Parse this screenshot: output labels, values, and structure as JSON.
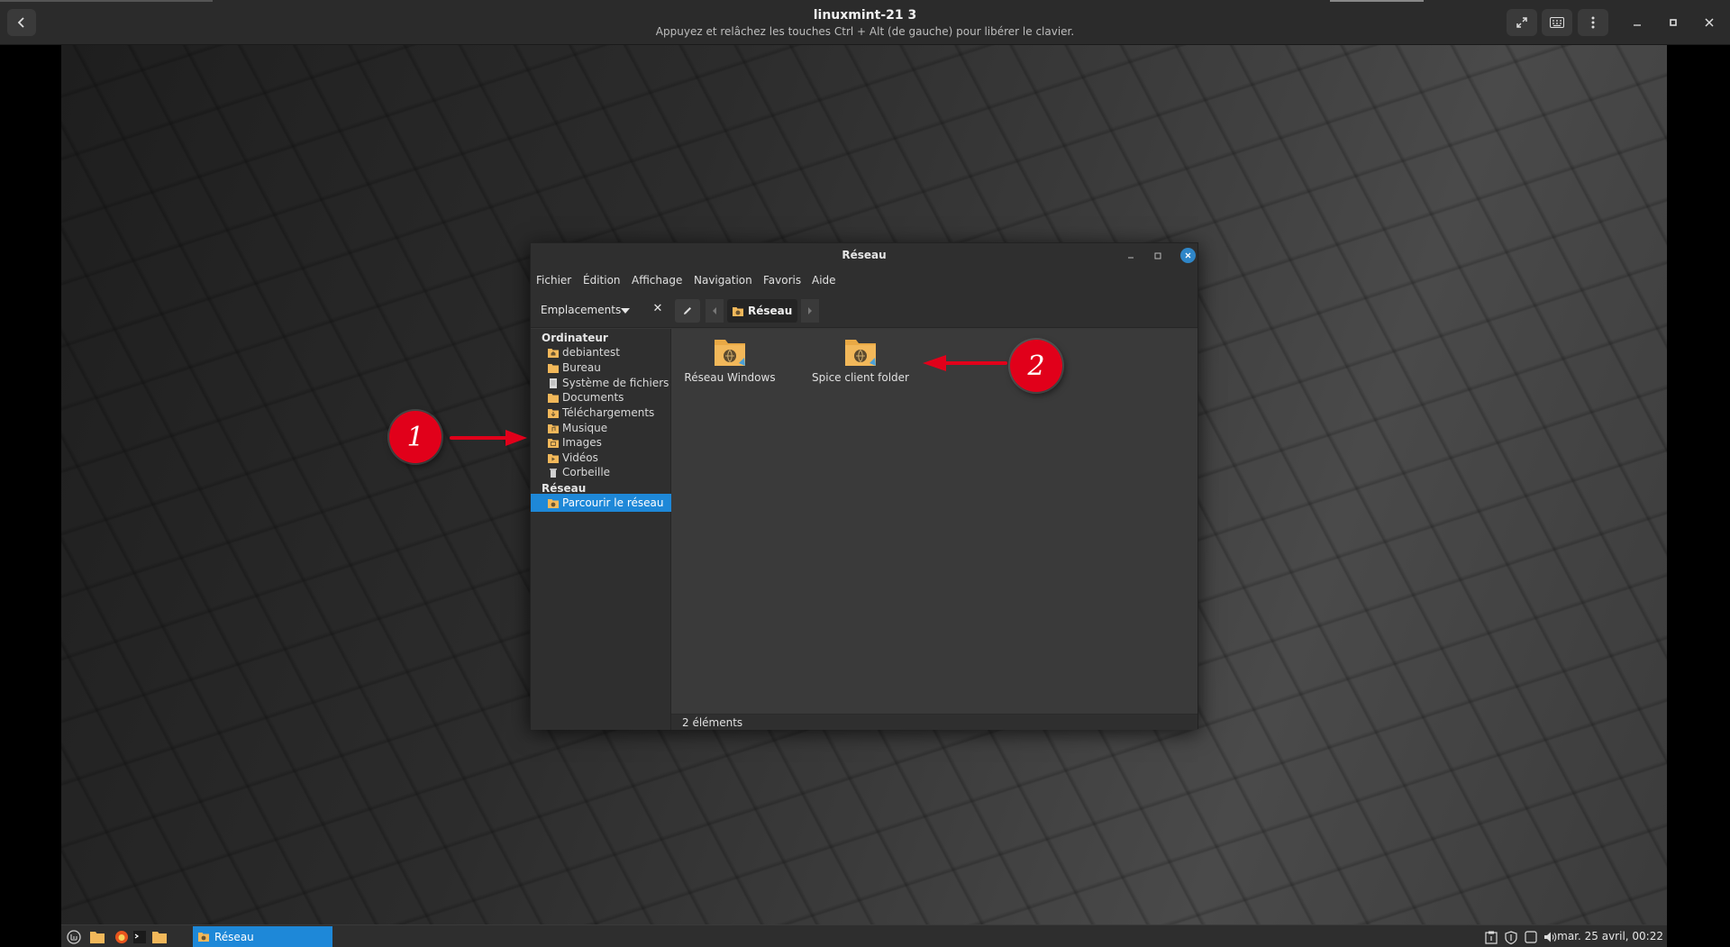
{
  "host": {
    "title": "linuxmint-21 3",
    "subtitle": "Appuyez et relâchez les touches Ctrl + Alt (de gauche) pour libérer le clavier.",
    "buttons": [
      "back-icon",
      "fullscreen-icon",
      "keyboard-icon",
      "kebab-menu-icon",
      "minimize-icon",
      "maximize-icon",
      "close-icon"
    ]
  },
  "window": {
    "title": "Réseau",
    "menu": [
      "Fichier",
      "Édition",
      "Affichage",
      "Navigation",
      "Favoris",
      "Aide"
    ],
    "toolbar": {
      "places_label": "Emplacements",
      "breadcrumb": "Réseau"
    },
    "sidebar": {
      "computer_heading": "Ordinateur",
      "computer_items": [
        {
          "label": "debiantest",
          "icon": "home-folder-icon"
        },
        {
          "label": "Bureau",
          "icon": "desktop-folder-icon"
        },
        {
          "label": "Système de fichiers",
          "icon": "filesystem-icon"
        },
        {
          "label": "Documents",
          "icon": "documents-folder-icon"
        },
        {
          "label": "Téléchargements",
          "icon": "downloads-folder-icon"
        },
        {
          "label": "Musique",
          "icon": "music-folder-icon"
        },
        {
          "label": "Images",
          "icon": "pictures-folder-icon"
        },
        {
          "label": "Vidéos",
          "icon": "videos-folder-icon"
        },
        {
          "label": "Corbeille",
          "icon": "trash-icon"
        }
      ],
      "network_heading": "Réseau",
      "network_items": [
        {
          "label": "Parcourir le réseau",
          "icon": "network-folder-icon",
          "selected": true
        }
      ]
    },
    "content": {
      "items": [
        {
          "label": "Réseau Windows",
          "icon": "network-folder-icon"
        },
        {
          "label": "Spice client folder",
          "icon": "network-folder-icon"
        }
      ]
    },
    "status": "2 éléments"
  },
  "annotations": {
    "callout_1": "1",
    "callout_2": "2",
    "color": "#e1001a"
  },
  "taskbar": {
    "launchers": [
      "mint-menu-icon",
      "files-icon",
      "firefox-icon",
      "terminal-icon",
      "folder-icon"
    ],
    "active_window": "Réseau",
    "tray": [
      "clipboard-icon",
      "shield-icon",
      "network-icon",
      "volume-icon"
    ],
    "clock": "mar. 25 avril, 00:22"
  },
  "colors": {
    "accent": "#1e88d8",
    "folder": "#f2b85a"
  }
}
